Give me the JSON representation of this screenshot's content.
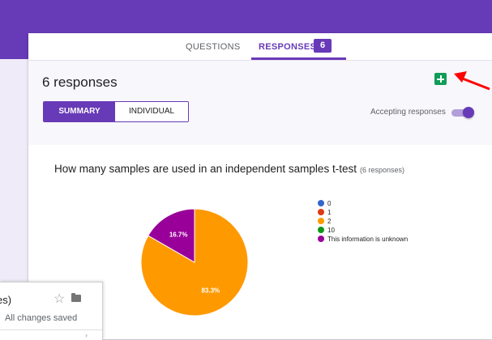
{
  "tabs": {
    "questions": "QUESTIONS",
    "responses": "RESPONSES",
    "responses_count": "6"
  },
  "header": {
    "title": "6 responses",
    "summary_label": "SUMMARY",
    "individual_label": "INDIVIDUAL",
    "accepting_label": "Accepting responses",
    "accepting_on": true
  },
  "question": {
    "text": "How many samples are used in an independent samples t-test",
    "subtext": "(6 responses)"
  },
  "chart_data": {
    "type": "pie",
    "categories": [
      "0",
      "1",
      "2",
      "10",
      "This information is unknown"
    ],
    "values": [
      0,
      0,
      83.3,
      0,
      16.7
    ],
    "colors": [
      "#3366cc",
      "#dc3912",
      "#ff9900",
      "#109618",
      "#990099"
    ],
    "labels": [
      "",
      "",
      "83.3%",
      "",
      "16.7%"
    ],
    "legend_position": "right"
  },
  "colors": {
    "brand": "#673ab7",
    "annotation_arrow": "#ff0000"
  },
  "overlay": {
    "title": "es)",
    "status": "All changes saved",
    "mini_icon": "›"
  }
}
